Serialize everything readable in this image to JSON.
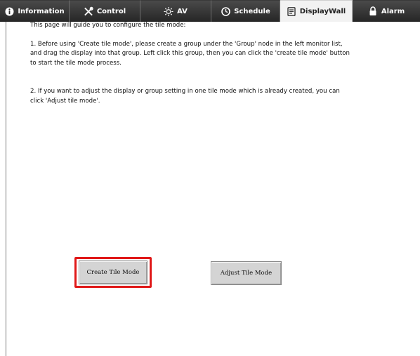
{
  "tabs": [
    {
      "label": "Information",
      "icon": "info-icon"
    },
    {
      "label": "Control",
      "icon": "tools-icon"
    },
    {
      "label": "AV",
      "icon": "brightness-icon"
    },
    {
      "label": "Schedule",
      "icon": "clock-icon"
    },
    {
      "label": "DisplayWall",
      "icon": "document-icon",
      "active": true
    },
    {
      "label": "Alarm",
      "icon": "lock-icon"
    }
  ],
  "content": {
    "intro": "This page will guide you to configure the tile mode:",
    "step1": "1. Before using 'Create tile mode', please create a group under the 'Group' node in the left monitor list, and drag the display into that group. Left click this group, then you can click the 'create tile mode' button to start the tile mode process.",
    "step2": "2. If you want to adjust the display or group setting in one tile mode which is already created, you can click 'Adjust tile mode'."
  },
  "buttons": {
    "create": "Create Tile Mode",
    "adjust": "Adjust Tile Mode"
  },
  "colors": {
    "tab_bg": "#2e2e2e",
    "tab_active_bg": "#f2f2f2",
    "highlight": "#e01818",
    "button_bg": "#d4d4d4"
  }
}
